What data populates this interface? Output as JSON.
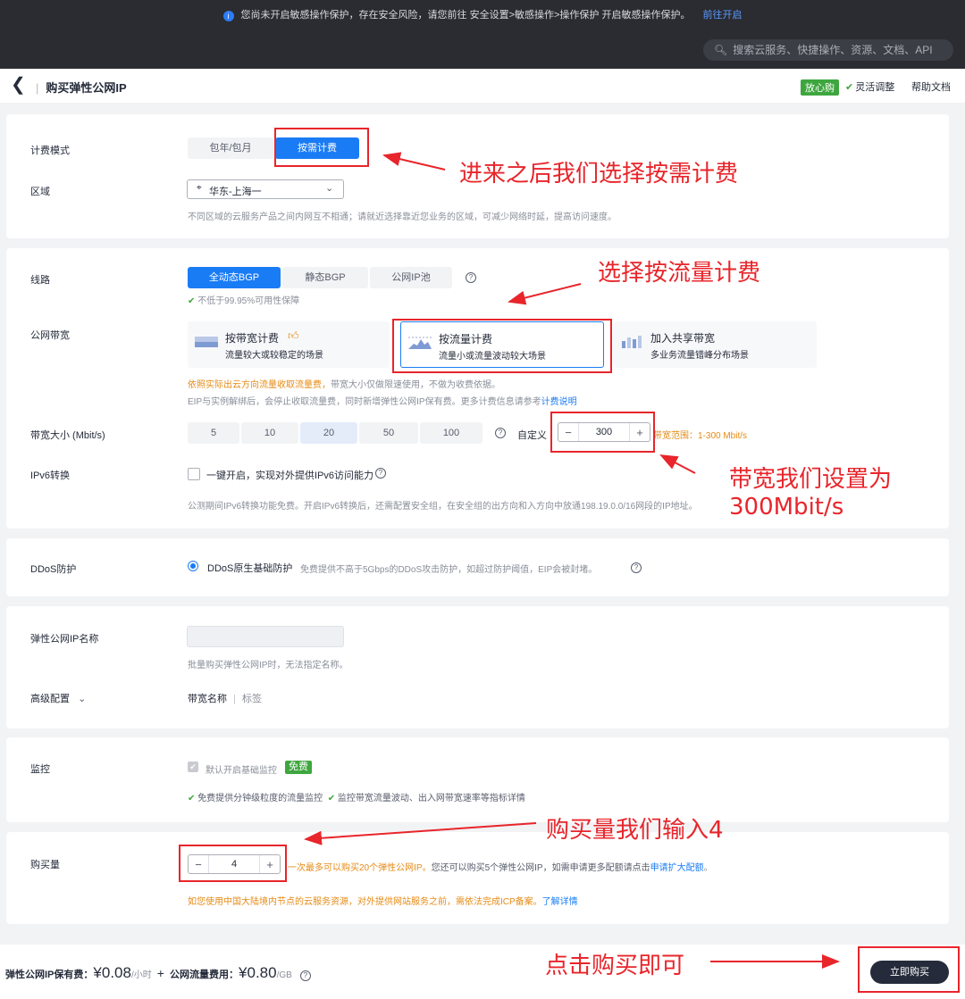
{
  "banner": {
    "text": "您尚未开启敏感操作保护，存在安全风险，请您前往 安全设置>敏感操作>操作保护 开启敏感操作保护。",
    "link": "前往开启"
  },
  "search": {
    "placeholder": "搜索云服务、快捷操作、资源、文档、API"
  },
  "page": {
    "title": "购买弹性公网IP",
    "badge": "放心购",
    "flex": "灵活调整",
    "help": "帮助文档"
  },
  "billing": {
    "label": "计费模式",
    "options": [
      "包年/包月",
      "按需计费"
    ],
    "region_label": "区域",
    "region_value": "华东-上海一",
    "region_hint": "不同区域的云服务产品之间内网互不相通；请就近选择靠近您业务的区域，可减少网络时延，提高访问速度。"
  },
  "line": {
    "label": "线路",
    "options": [
      "全动态BGP",
      "静态BGP",
      "公网IP池"
    ],
    "sla": "不低于99.95%可用性保障"
  },
  "bandwidth": {
    "label": "公网带宽",
    "cards": [
      {
        "title": "按带宽计费",
        "desc": "流量较大或较稳定的场景"
      },
      {
        "title": "按流量计费",
        "desc": "流量小或流量波动较大场景"
      },
      {
        "title": "加入共享带宽",
        "desc": "多业务流量错峰分布场景"
      }
    ],
    "note_orange": "依照实际出云方向流量收取流量费，",
    "note_rest": "带宽大小仅做限速使用，不做为收费依据。",
    "note2": "EIP与实例解绑后，会停止收取流量费，同时新增弹性公网IP保有费。更多计费信息请参考",
    "note2_link": "计费说明",
    "size_label": "带宽大小 (Mbit/s)",
    "sizes": [
      "5",
      "10",
      "20",
      "50",
      "100"
    ],
    "custom_label": "自定义",
    "custom_value": "300",
    "range": "带宽范围：1-300 Mbit/s"
  },
  "ipv6": {
    "label": "IPv6转换",
    "option": "一键开启，实现对外提供IPv6访问能力",
    "hint": "公测期间IPv6转换功能免费。开启IPv6转换后，还需配置安全组，在安全组的出方向和入方向中放通198.19.0.0/16网段的IP地址。"
  },
  "ddos": {
    "label": "DDoS防护",
    "option": "DDoS原生基础防护",
    "desc": "免费提供不高于5Gbps的DDoS攻击防护，如超过防护阈值，EIP会被封堵。"
  },
  "name": {
    "label": "弹性公网IP名称",
    "hint": "批量购买弹性公网IP时，无法指定名称。",
    "adv_label": "高级配置",
    "adv_items": [
      "带宽名称",
      "|",
      "标签"
    ]
  },
  "monitor": {
    "label": "监控",
    "checkbox": "默认开启基础监控",
    "free": "免费",
    "f1": "免费提供分钟级粒度的流量监控",
    "f2": "监控带宽流量波动、出入网带宽速率等指标详情"
  },
  "quantity": {
    "label": "购买量",
    "value": "4",
    "hint_orange": "一次最多可以购买20个弹性公网IP。",
    "hint_rest": "您还可以购买5个弹性公网IP，如需申请更多配额请点击",
    "hint_link": "申请扩大配额",
    "hint_end": "。",
    "icp": "如您使用中国大陆境内节点的云服务资源，对外提供网站服务之前，需依法完成ICP备案。",
    "icp_link": "了解详情"
  },
  "footer": {
    "fee1_label": "弹性公网IP保有费：",
    "fee1_value": "¥0.08",
    "fee1_unit": "/小时",
    "plus": "+",
    "fee2_label": "公网流量费用：",
    "fee2_value": "¥0.80",
    "fee2_unit": "/GB",
    "buy": "立即购买"
  },
  "annotations": {
    "a1": "进来之后我们选择按需计费",
    "a2": "选择按流量计费",
    "a3_line1": "带宽我们设置为",
    "a3_line2": "300Mbit/s",
    "a4": "购买量我们输入4",
    "a5": "点击购买即可"
  }
}
